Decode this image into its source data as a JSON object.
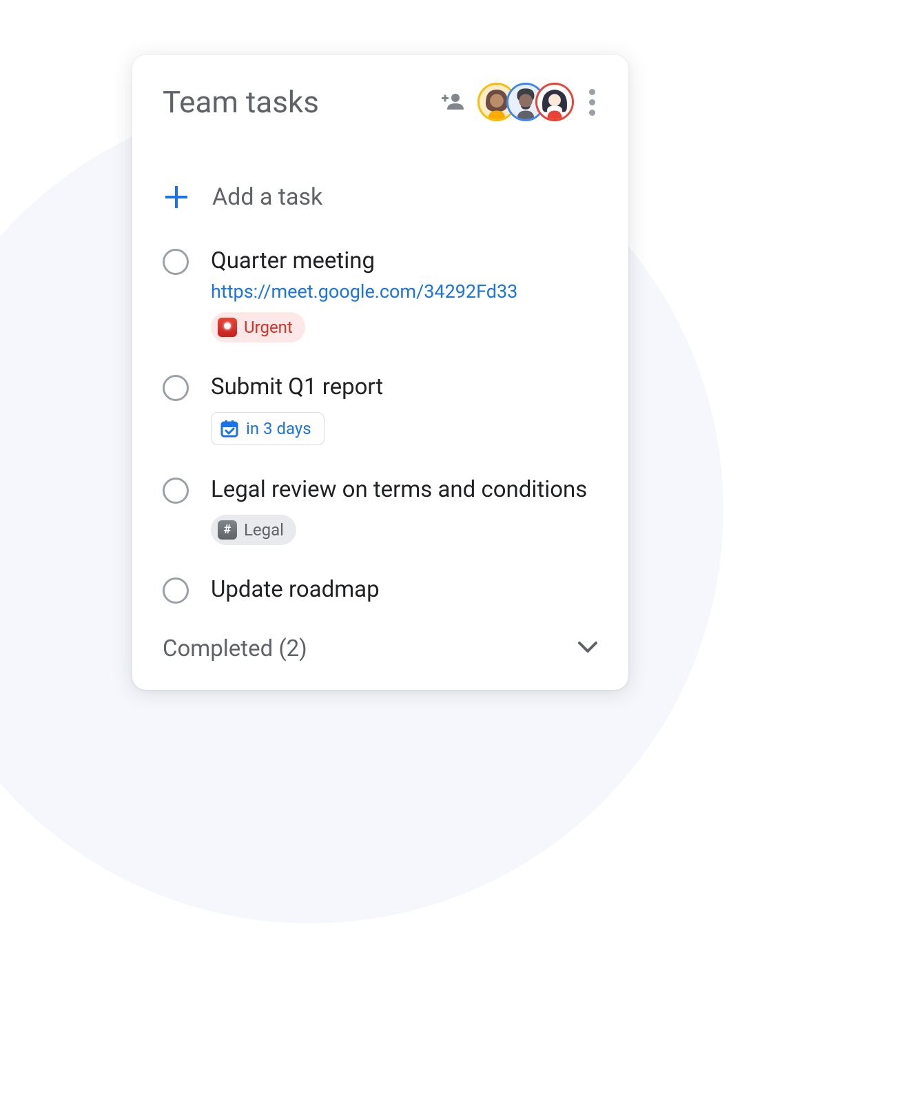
{
  "header": {
    "title": "Team tasks",
    "avatars": [
      {
        "ring_color": "#fbbc04"
      },
      {
        "ring_color": "#4285f4"
      },
      {
        "ring_color": "#ea4335"
      }
    ]
  },
  "add_task_label": "Add a task",
  "tasks": [
    {
      "title": "Quarter meeting",
      "link": "https://meet.google.com/34292Fd33",
      "tag": {
        "type": "urgent",
        "label": "Urgent"
      }
    },
    {
      "title": "Submit Q1 report",
      "chip": {
        "type": "date",
        "label": "in 3 days"
      }
    },
    {
      "title": "Legal review on terms and conditions",
      "tag": {
        "type": "legal",
        "label": "Legal"
      }
    },
    {
      "title": "Update roadmap"
    }
  ],
  "completed": {
    "label": "Completed",
    "count": 2,
    "display": "Completed (2)"
  }
}
